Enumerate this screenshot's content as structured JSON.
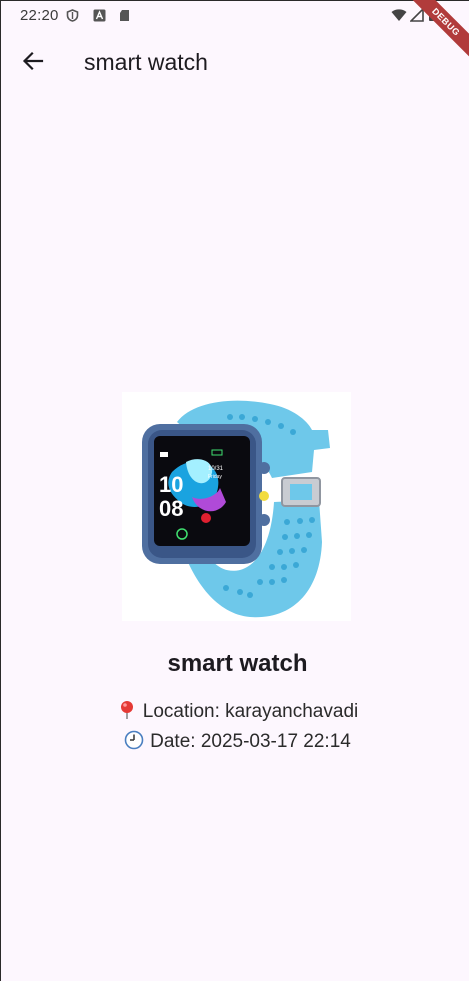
{
  "status_bar": {
    "time": "22:20",
    "icons_left": [
      "shield-icon",
      "font-a-icon",
      "sd-card-icon"
    ],
    "icons_right": [
      "wifi-icon",
      "signal-icon",
      "battery-icon"
    ]
  },
  "debug_banner": "DEBUG",
  "app_bar": {
    "back_icon": "arrow-left-icon",
    "title": "smart watch"
  },
  "product": {
    "image": "smart-watch-image",
    "name": "smart watch",
    "location_label": "Location: karayanchavadi",
    "date_label": "Date: 2025-03-17 22:14",
    "location_icon": "pin-icon",
    "date_icon": "clock-icon"
  },
  "colors": {
    "background": "#fdf7fe",
    "text": "#1d1b20",
    "watch_band": "#6ec8ea",
    "debug_banner": "#b13b3b"
  }
}
